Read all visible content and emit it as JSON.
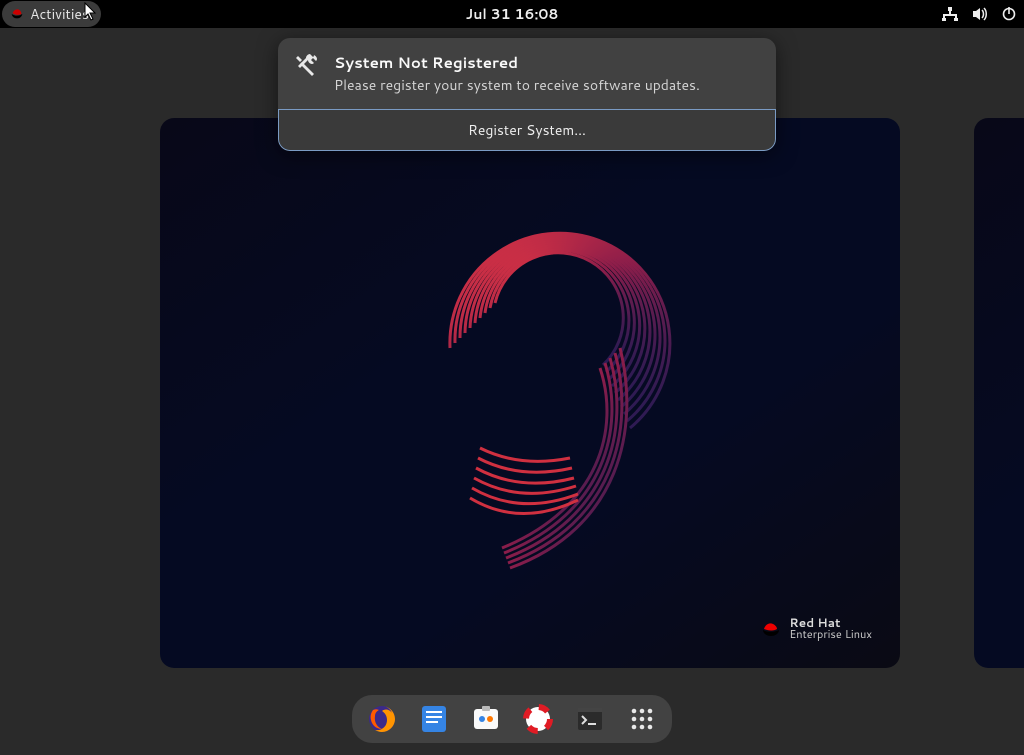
{
  "topbar": {
    "activities_label": "Activities",
    "clock": "Jul 31  16:08"
  },
  "notification": {
    "title": "System Not Registered",
    "message": "Please register your system to receive software updates.",
    "button_label": "Register System…"
  },
  "wallpaper_logo": {
    "top": "Red Hat",
    "bottom": "Enterprise Linux"
  },
  "dash": {
    "firefox": "Firefox",
    "texteditor": "Text Editor",
    "software": "Software",
    "help": "Help",
    "terminal": "Terminal",
    "apps": "Show Applications"
  }
}
